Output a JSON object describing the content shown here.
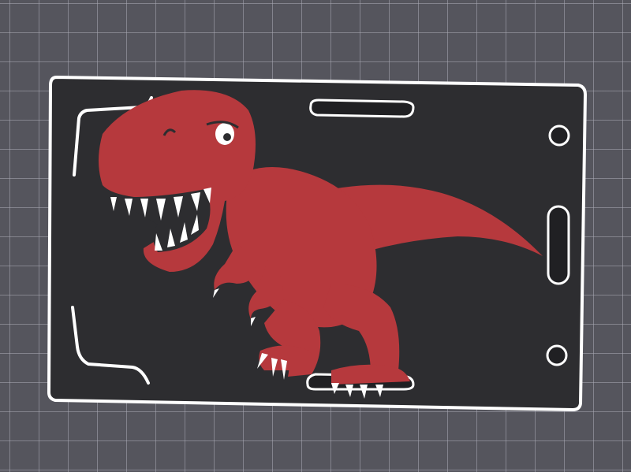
{
  "viewport": {
    "title": ""
  },
  "colors": {
    "background": "#55555d",
    "grid": "#aaaab4",
    "plate": "#2d2d30",
    "outline": "#ffffff",
    "dino": "#b6393d",
    "teeth": "#ffffff",
    "slot": "#202023"
  },
  "icons": {
    "model": "trex-icon",
    "plate": "badge-plate",
    "holes": "mount-hole-icon"
  }
}
